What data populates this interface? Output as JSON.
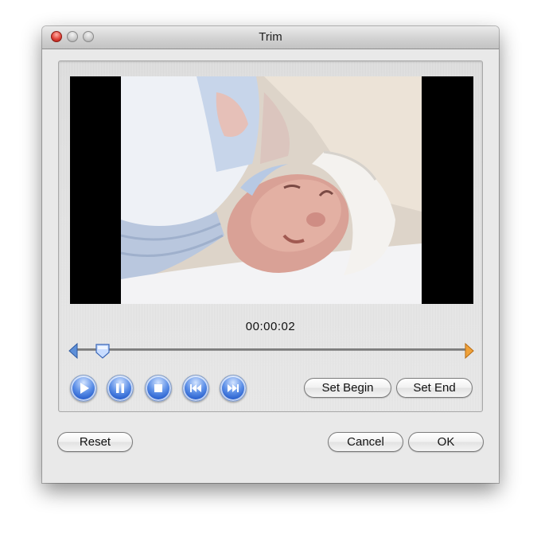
{
  "window": {
    "title": "Trim"
  },
  "player": {
    "timecode": "00:00:02",
    "position_fraction": 0.07,
    "controls": [
      "play-icon",
      "pause-icon",
      "stop-icon",
      "previous-icon",
      "next-icon"
    ]
  },
  "trim": {
    "set_begin_label": "Set Begin",
    "set_end_label": "Set End"
  },
  "footer": {
    "reset_label": "Reset",
    "cancel_label": "Cancel",
    "ok_label": "OK"
  },
  "colors": {
    "accent_blue": "#3b74d8",
    "end_marker_orange": "#e08a1e",
    "close_red": "#e0443a"
  }
}
